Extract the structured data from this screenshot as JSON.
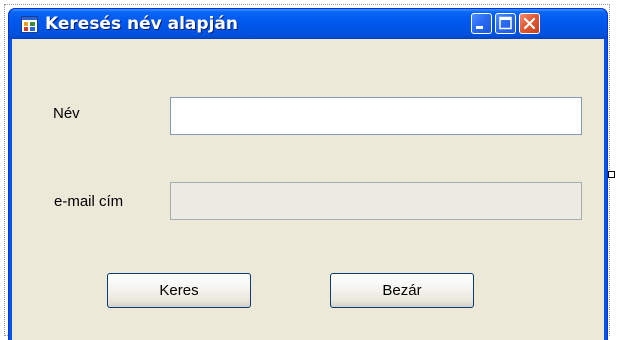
{
  "window": {
    "title": "Keresés név alapján",
    "icon": "form-icon"
  },
  "caption_buttons": {
    "minimize_icon": "minimize-icon",
    "maximize_icon": "maximize-icon",
    "close_icon": "close-icon"
  },
  "form": {
    "name_label": "Név",
    "name_value": "",
    "email_label": "e-mail cím",
    "email_value": "",
    "search_button": "Keres",
    "close_button": "Bezár"
  },
  "colors": {
    "titlebar": "#0054e3",
    "close_button": "#e25b35",
    "client": "#ece9d8"
  }
}
